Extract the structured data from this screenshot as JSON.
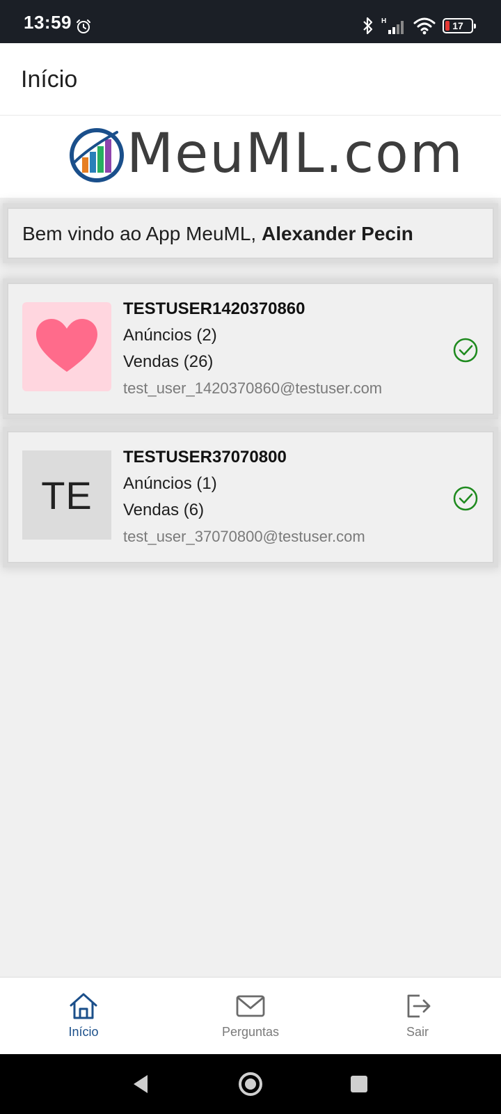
{
  "status_bar": {
    "time": "13:59",
    "battery_level": "17",
    "icons": [
      "alarm-icon",
      "bluetooth-icon",
      "signal-icon",
      "wifi-icon",
      "battery-icon"
    ],
    "network_type": "H"
  },
  "header": {
    "title": "Início"
  },
  "logo": {
    "text": "MeuML.com",
    "bar_colors": [
      "#e67e22",
      "#2980b9",
      "#27ae60",
      "#8e44ad"
    ],
    "ring_color": "#1a4f8b"
  },
  "welcome": {
    "prefix": "Bem vindo ao App MeuML, ",
    "user_name": "Alexander Pecin"
  },
  "accounts": [
    {
      "name": "TESTUSER1420370860",
      "ads": "Anúncios (2)",
      "sales": "Vendas (26)",
      "email": "test_user_1420370860@testuser.com",
      "avatar": "heart-icon",
      "status": "check-circle-icon"
    },
    {
      "name": "TESTUSER37070800",
      "ads": "Anúncios (1)",
      "sales": "Vendas (6)",
      "email": "test_user_37070800@testuser.com",
      "avatar_initials": "TE",
      "status": "check-circle-icon"
    }
  ],
  "bottom_nav": {
    "items": [
      {
        "label": "Início",
        "icon": "home-icon",
        "active": true
      },
      {
        "label": "Perguntas",
        "icon": "mail-icon",
        "active": false
      },
      {
        "label": "Sair",
        "icon": "logout-icon",
        "active": false
      }
    ]
  },
  "colors": {
    "accent": "#1b4f8a",
    "success": "#1e8a1e",
    "heart": "#ff6b8b",
    "status_bar_bg": "#1b1f26"
  }
}
